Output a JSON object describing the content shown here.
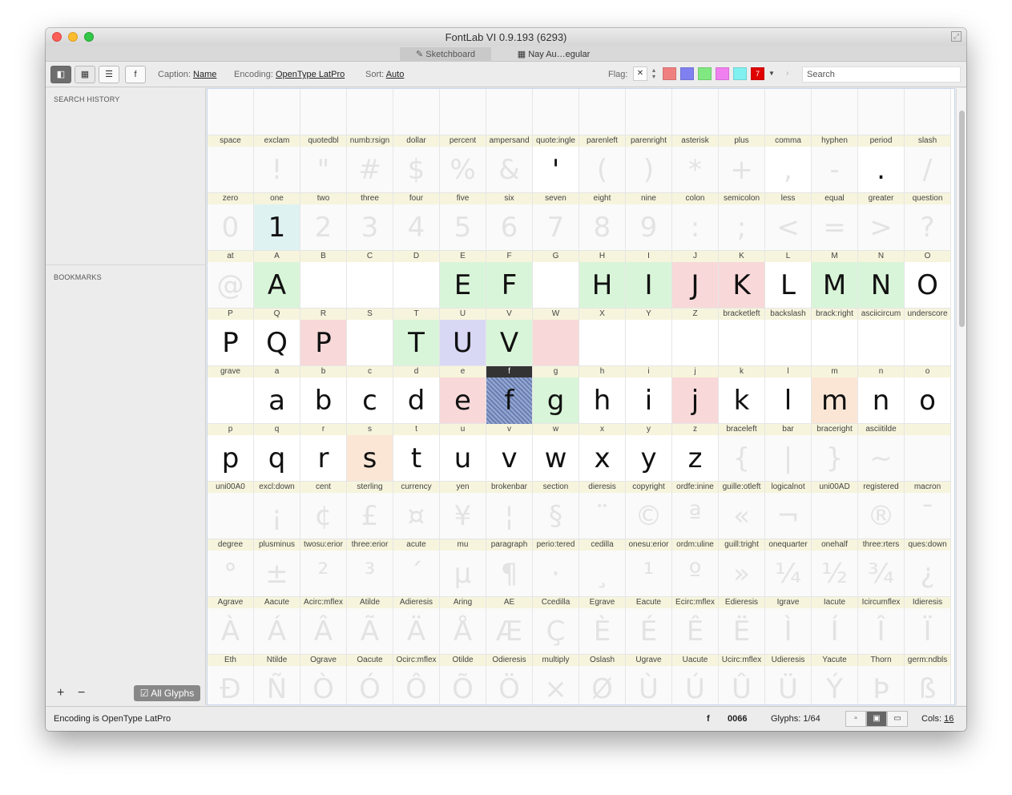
{
  "window": {
    "title": "FontLab VI 0.9.193 (6293)"
  },
  "tabs": [
    {
      "label": "Sketchboard",
      "icon": "pencil-icon"
    },
    {
      "label": "Nay Au…egular",
      "icon": "grid-icon"
    }
  ],
  "toolbar": {
    "f_button": "f",
    "caption_label": "Caption:",
    "caption_value": "Name",
    "encoding_label": "Encoding:",
    "encoding_value": "OpenType LatPro",
    "sort_label": "Sort:",
    "sort_value": "Auto",
    "flag_label": "Flag:",
    "flag_clear": "✕",
    "flag_colors": [
      "#f08080",
      "#8080f0",
      "#80e880",
      "#f080f0",
      "#80f0f0",
      "#e00000"
    ],
    "flag_seven": "7",
    "search_placeholder": "Search"
  },
  "sidebar": {
    "search_history": "SEARCH HISTORY",
    "bookmarks": "BOOKMARKS",
    "add": "+",
    "remove": "−",
    "all_glyphs": "All Glyphs"
  },
  "glyphs": [
    {
      "n": "space",
      "g": ""
    },
    {
      "n": "exclam",
      "g": "!"
    },
    {
      "n": "quotedbl",
      "g": "\""
    },
    {
      "n": "numb:rsign",
      "g": "#"
    },
    {
      "n": "dollar",
      "g": "$"
    },
    {
      "n": "percent",
      "g": "%"
    },
    {
      "n": "ampersand",
      "g": "&"
    },
    {
      "n": "quote:ingle",
      "g": "'",
      "d": 1,
      "bg": "#fff"
    },
    {
      "n": "parenleft",
      "g": "("
    },
    {
      "n": "parenright",
      "g": ")"
    },
    {
      "n": "asterisk",
      "g": "*"
    },
    {
      "n": "plus",
      "g": "+"
    },
    {
      "n": "comma",
      "g": ",",
      "bg": "#fff"
    },
    {
      "n": "hyphen",
      "g": "-"
    },
    {
      "n": "period",
      "g": ".",
      "d": 1,
      "bg": "#fff"
    },
    {
      "n": "slash",
      "g": "/"
    },
    {
      "n": "zero",
      "g": "0"
    },
    {
      "n": "one",
      "g": "1",
      "d": 1,
      "bg": "#dff2f2"
    },
    {
      "n": "two",
      "g": "2"
    },
    {
      "n": "three",
      "g": "3"
    },
    {
      "n": "four",
      "g": "4"
    },
    {
      "n": "five",
      "g": "5"
    },
    {
      "n": "six",
      "g": "6"
    },
    {
      "n": "seven",
      "g": "7"
    },
    {
      "n": "eight",
      "g": "8"
    },
    {
      "n": "nine",
      "g": "9"
    },
    {
      "n": "colon",
      "g": ":"
    },
    {
      "n": "semicolon",
      "g": ";"
    },
    {
      "n": "less",
      "g": "<"
    },
    {
      "n": "equal",
      "g": "="
    },
    {
      "n": "greater",
      "g": ">"
    },
    {
      "n": "question",
      "g": "?"
    },
    {
      "n": "at",
      "g": "@"
    },
    {
      "n": "A",
      "g": "A",
      "d": 1,
      "bg": "#d9f5d9"
    },
    {
      "n": "B",
      "g": "",
      "bg": "#fff"
    },
    {
      "n": "C",
      "g": "",
      "bg": "#fff"
    },
    {
      "n": "D",
      "g": "",
      "bg": "#fff"
    },
    {
      "n": "E",
      "g": "E",
      "d": 1,
      "bg": "#d9f5d9"
    },
    {
      "n": "F",
      "g": "F",
      "d": 1,
      "bg": "#d9f5d9"
    },
    {
      "n": "G",
      "g": "",
      "bg": "#fff"
    },
    {
      "n": "H",
      "g": "H",
      "d": 1,
      "bg": "#d9f5d9"
    },
    {
      "n": "I",
      "g": "I",
      "d": 1,
      "bg": "#d9f5d9"
    },
    {
      "n": "J",
      "g": "J",
      "d": 1,
      "bg": "#f8d8d8"
    },
    {
      "n": "K",
      "g": "K",
      "d": 1,
      "bg": "#f8d8d8"
    },
    {
      "n": "L",
      "g": "L",
      "d": 1,
      "bg": "#fff"
    },
    {
      "n": "M",
      "g": "M",
      "d": 1,
      "bg": "#d9f5d9"
    },
    {
      "n": "N",
      "g": "N",
      "d": 1,
      "bg": "#d9f5d9"
    },
    {
      "n": "O",
      "g": "O",
      "d": 1,
      "bg": "#fff"
    },
    {
      "n": "P",
      "g": "P",
      "d": 1,
      "bg": "#fff"
    },
    {
      "n": "Q",
      "g": "Q",
      "d": 1,
      "bg": "#fff"
    },
    {
      "n": "R",
      "g": "P",
      "d": 1,
      "bg": "#f8d8d8"
    },
    {
      "n": "S",
      "g": "",
      "bg": "#fff"
    },
    {
      "n": "T",
      "g": "T",
      "d": 1,
      "bg": "#d9f5d9"
    },
    {
      "n": "U",
      "g": "U",
      "d": 1,
      "bg": "#d8d8f5"
    },
    {
      "n": "V",
      "g": "V",
      "d": 1,
      "bg": "#d9f5d9"
    },
    {
      "n": "W",
      "g": "",
      "bg": "#f8d8d8"
    },
    {
      "n": "X",
      "g": "",
      "bg": "#fff"
    },
    {
      "n": "Y",
      "g": "",
      "bg": "#fff"
    },
    {
      "n": "Z",
      "g": "",
      "bg": "#fff"
    },
    {
      "n": "bracketleft",
      "g": "",
      "bg": "#fff"
    },
    {
      "n": "backslash",
      "g": "",
      "bg": "#fff"
    },
    {
      "n": "brack:right",
      "g": "",
      "bg": "#fff"
    },
    {
      "n": "asciicircum",
      "g": "",
      "bg": "#fff"
    },
    {
      "n": "underscore",
      "g": "",
      "bg": "#fff"
    },
    {
      "n": "grave",
      "g": "",
      "bg": "#fff"
    },
    {
      "n": "a",
      "g": "a",
      "d": 1,
      "bg": "#fff"
    },
    {
      "n": "b",
      "g": "b",
      "d": 1,
      "bg": "#fff"
    },
    {
      "n": "c",
      "g": "c",
      "d": 1,
      "bg": "#fff"
    },
    {
      "n": "d",
      "g": "d",
      "d": 1,
      "bg": "#fff"
    },
    {
      "n": "e",
      "g": "e",
      "d": 1,
      "bg": "#f8d8d8"
    },
    {
      "n": "f",
      "g": "f",
      "d": 1,
      "sel": 1
    },
    {
      "n": "g",
      "g": "g",
      "d": 1,
      "bg": "#d9f5d9"
    },
    {
      "n": "h",
      "g": "h",
      "d": 1,
      "bg": "#fff"
    },
    {
      "n": "i",
      "g": "i",
      "d": 1,
      "bg": "#fff"
    },
    {
      "n": "j",
      "g": "j",
      "d": 1,
      "bg": "#f8d8d8"
    },
    {
      "n": "k",
      "g": "k",
      "d": 1,
      "bg": "#fff"
    },
    {
      "n": "l",
      "g": "l",
      "d": 1,
      "bg": "#fff"
    },
    {
      "n": "m",
      "g": "m",
      "d": 1,
      "bg": "#fbe6d6"
    },
    {
      "n": "n",
      "g": "n",
      "d": 1,
      "bg": "#fff"
    },
    {
      "n": "o",
      "g": "o",
      "d": 1,
      "bg": "#fff"
    },
    {
      "n": "p",
      "g": "p",
      "d": 1,
      "bg": "#fff"
    },
    {
      "n": "q",
      "g": "q",
      "d": 1,
      "bg": "#fff"
    },
    {
      "n": "r",
      "g": "r",
      "d": 1,
      "bg": "#fff"
    },
    {
      "n": "s",
      "g": "s",
      "d": 1,
      "bg": "#fbe6d6"
    },
    {
      "n": "t",
      "g": "t",
      "d": 1,
      "bg": "#fff"
    },
    {
      "n": "u",
      "g": "u",
      "d": 1,
      "bg": "#fff"
    },
    {
      "n": "v",
      "g": "v",
      "d": 1,
      "bg": "#fff"
    },
    {
      "n": "w",
      "g": "w",
      "d": 1,
      "bg": "#fff"
    },
    {
      "n": "x",
      "g": "x",
      "d": 1,
      "bg": "#fff"
    },
    {
      "n": "y",
      "g": "y",
      "d": 1,
      "bg": "#fff"
    },
    {
      "n": "z",
      "g": "z",
      "d": 1,
      "bg": "#fff"
    },
    {
      "n": "braceleft",
      "g": "{"
    },
    {
      "n": "bar",
      "g": "|"
    },
    {
      "n": "braceright",
      "g": "}"
    },
    {
      "n": "asciitilde",
      "g": "~"
    },
    {
      "n": "",
      "g": ""
    },
    {
      "n": "uni00A0",
      "g": ""
    },
    {
      "n": "excl:down",
      "g": "¡"
    },
    {
      "n": "cent",
      "g": "¢"
    },
    {
      "n": "sterling",
      "g": "£"
    },
    {
      "n": "currency",
      "g": "¤"
    },
    {
      "n": "yen",
      "g": "¥"
    },
    {
      "n": "brokenbar",
      "g": "¦"
    },
    {
      "n": "section",
      "g": "§"
    },
    {
      "n": "dieresis",
      "g": "¨"
    },
    {
      "n": "copyright",
      "g": "©"
    },
    {
      "n": "ordfe:inine",
      "g": "ª"
    },
    {
      "n": "guille:otleft",
      "g": "«"
    },
    {
      "n": "logicalnot",
      "g": "¬"
    },
    {
      "n": "uni00AD",
      "g": ""
    },
    {
      "n": "registered",
      "g": "®"
    },
    {
      "n": "macron",
      "g": "¯"
    },
    {
      "n": "degree",
      "g": "°"
    },
    {
      "n": "plusminus",
      "g": "±"
    },
    {
      "n": "twosu:erior",
      "g": "²"
    },
    {
      "n": "three:erior",
      "g": "³"
    },
    {
      "n": "acute",
      "g": "´"
    },
    {
      "n": "mu",
      "g": "µ"
    },
    {
      "n": "paragraph",
      "g": "¶"
    },
    {
      "n": "perio:tered",
      "g": "·"
    },
    {
      "n": "cedilla",
      "g": "¸"
    },
    {
      "n": "onesu:erior",
      "g": "¹"
    },
    {
      "n": "ordm:uline",
      "g": "º"
    },
    {
      "n": "guill:tright",
      "g": "»"
    },
    {
      "n": "onequarter",
      "g": "¼"
    },
    {
      "n": "onehalf",
      "g": "½"
    },
    {
      "n": "three:rters",
      "g": "¾"
    },
    {
      "n": "ques:down",
      "g": "¿"
    },
    {
      "n": "Agrave",
      "g": "À"
    },
    {
      "n": "Aacute",
      "g": "Á"
    },
    {
      "n": "Acirc:mflex",
      "g": "Â"
    },
    {
      "n": "Atilde",
      "g": "Ã"
    },
    {
      "n": "Adieresis",
      "g": "Ä"
    },
    {
      "n": "Aring",
      "g": "Å"
    },
    {
      "n": "AE",
      "g": "Æ"
    },
    {
      "n": "Ccedilla",
      "g": "Ç"
    },
    {
      "n": "Egrave",
      "g": "È"
    },
    {
      "n": "Eacute",
      "g": "É"
    },
    {
      "n": "Ecirc:mflex",
      "g": "Ê"
    },
    {
      "n": "Edieresis",
      "g": "Ë"
    },
    {
      "n": "Igrave",
      "g": "Ì"
    },
    {
      "n": "Iacute",
      "g": "Í"
    },
    {
      "n": "Icircumflex",
      "g": "Î"
    },
    {
      "n": "Idieresis",
      "g": "Ï"
    },
    {
      "n": "Eth",
      "g": "Ð"
    },
    {
      "n": "Ntilde",
      "g": "Ñ"
    },
    {
      "n": "Ograve",
      "g": "Ò"
    },
    {
      "n": "Oacute",
      "g": "Ó"
    },
    {
      "n": "Ocirc:mflex",
      "g": "Ô"
    },
    {
      "n": "Otilde",
      "g": "Õ"
    },
    {
      "n": "Odieresis",
      "g": "Ö"
    },
    {
      "n": "multiply",
      "g": "×"
    },
    {
      "n": "Oslash",
      "g": "Ø"
    },
    {
      "n": "Ugrave",
      "g": "Ù"
    },
    {
      "n": "Uacute",
      "g": "Ú"
    },
    {
      "n": "Ucirc:mflex",
      "g": "Û"
    },
    {
      "n": "Udieresis",
      "g": "Ü"
    },
    {
      "n": "Yacute",
      "g": "Ý"
    },
    {
      "n": "Thorn",
      "g": "Þ"
    },
    {
      "n": "germ:ndbls",
      "g": "ß"
    }
  ],
  "status": {
    "encoding_text": "Encoding is OpenType LatPro",
    "glyph_char": "f",
    "unicode": "0066",
    "glyphs_count": "Glyphs: 1/64",
    "cols_label": "Cols:",
    "cols_value": "16"
  }
}
